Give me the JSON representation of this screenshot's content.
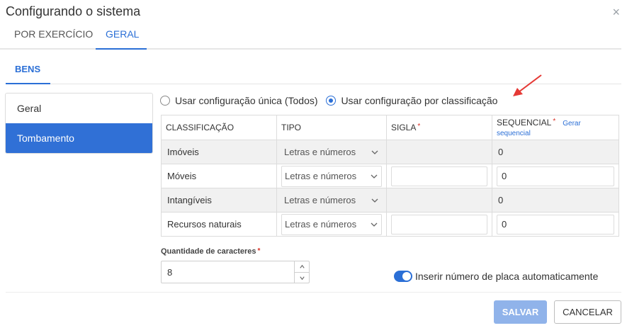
{
  "dialog": {
    "title": "Configurando o sistema",
    "close_label": "×"
  },
  "tabs": [
    {
      "label": "POR EXERCÍCIO"
    },
    {
      "label": "GERAL"
    }
  ],
  "subtab": {
    "label": "BENS"
  },
  "sidebar": {
    "items": [
      {
        "label": "Geral"
      },
      {
        "label": "Tombamento"
      }
    ]
  },
  "radios": [
    {
      "label": "Usar configuração única (Todos)",
      "checked": false
    },
    {
      "label": "Usar configuração por classificação",
      "checked": true
    }
  ],
  "table": {
    "headers": {
      "classificacao": "CLASSIFICAÇÃO",
      "tipo": "TIPO",
      "sigla": "SIGLA",
      "sequencial": "SEQUENCIAL",
      "required_mark": "*",
      "gerar_link": "Gerar sequencial"
    },
    "rows": [
      {
        "classificacao": "Imóveis",
        "tipo": "Letras e números",
        "sigla": "",
        "sequencial": "0"
      },
      {
        "classificacao": "Móveis",
        "tipo": "Letras e números",
        "sigla": "",
        "sequencial": "0"
      },
      {
        "classificacao": "Intangíveis",
        "tipo": "Letras e números",
        "sigla": "",
        "sequencial": "0"
      },
      {
        "classificacao": "Recursos naturais",
        "tipo": "Letras e números",
        "sigla": "",
        "sequencial": "0"
      }
    ]
  },
  "quantidade": {
    "label": "Quantidade de caracteres",
    "required_mark": "*",
    "value": "8"
  },
  "toggle": {
    "label": "Inserir número de placa automaticamente",
    "on": true
  },
  "buttons": {
    "save": "SALVAR",
    "cancel": "CANCELAR"
  },
  "colors": {
    "accent": "#2b6fd6",
    "save_disabled": "#90b3ea",
    "required": "#d93025",
    "annotation_arrow": "#e53935"
  }
}
